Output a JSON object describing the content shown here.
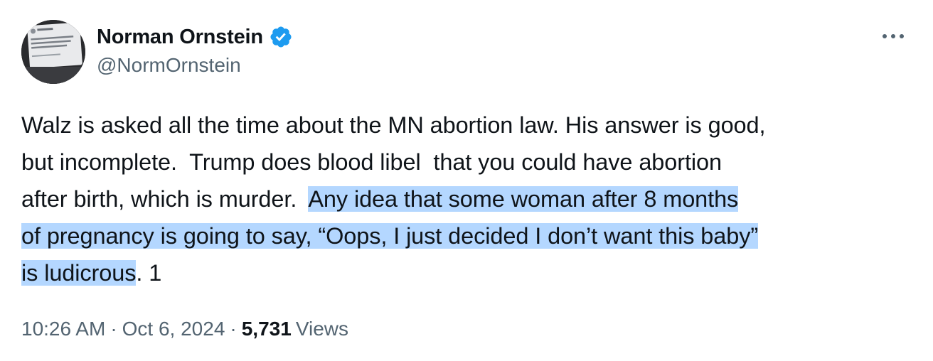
{
  "author": {
    "display_name": "Norman Ornstein",
    "handle": "@NormOrnstein",
    "verified_icon": "verified-badge-icon",
    "verified_color": "#1d9bf0"
  },
  "more_icon": "more-horizontal-icon",
  "body": {
    "line1": "Walz is asked all the time about the MN abortion law. His answer is good,",
    "line2": "but incomplete.  Trump does blood libel  that you could have abortion",
    "line3_plain": "after birth, which is murder.  ",
    "line3_highlight": "Any idea that some woman after 8 months",
    "line4_highlight": "of pregnancy is going to say, “Oops, I just decided I don’t want this baby”",
    "line5_highlight": "is ludicrous",
    "line5_plain": ". 1",
    "highlight_color": "#b4d7ff"
  },
  "meta": {
    "time": "10:26 AM",
    "date": "Oct 6, 2024",
    "separator": "·",
    "views_count": "5,731",
    "views_label": "Views"
  }
}
